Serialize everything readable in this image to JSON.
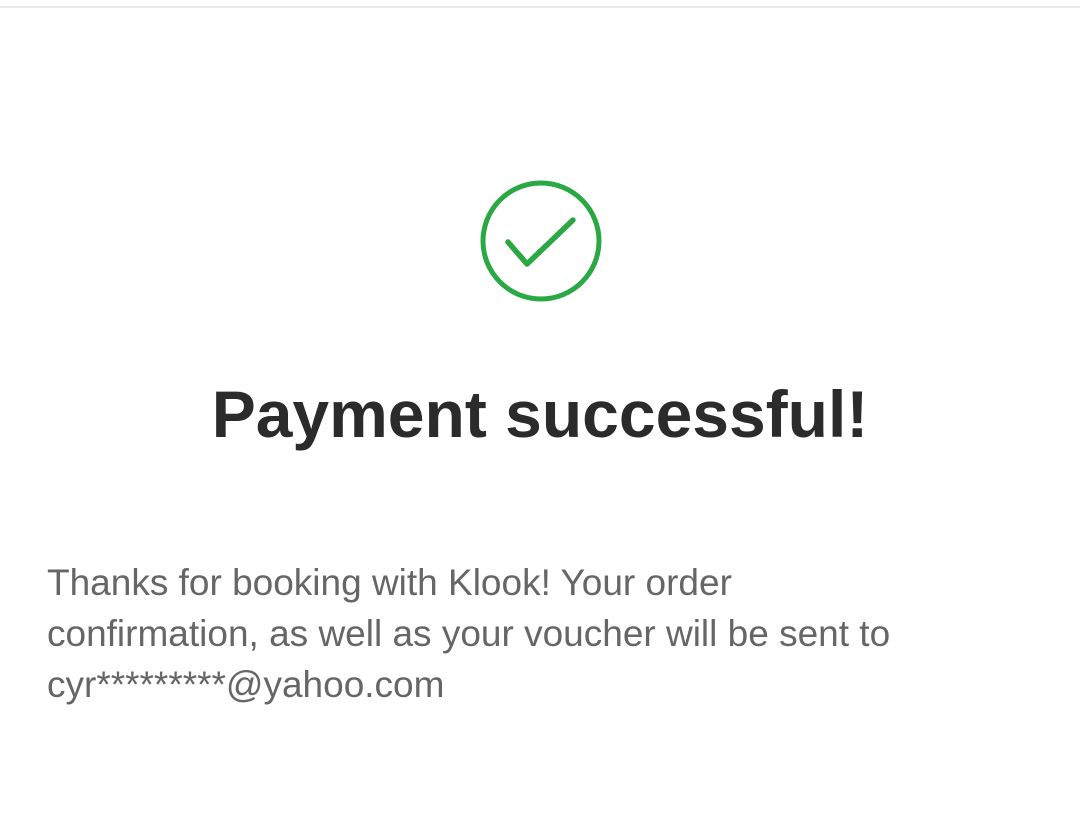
{
  "status": {
    "icon": "check-circle-icon",
    "color": "#2aa843"
  },
  "title": "Payment successful!",
  "message": {
    "line1": "Thanks for booking with Klook! Your order",
    "line2": "confirmation, as well as your voucher will be sent to",
    "email": "cyr*********@yahoo.com"
  }
}
